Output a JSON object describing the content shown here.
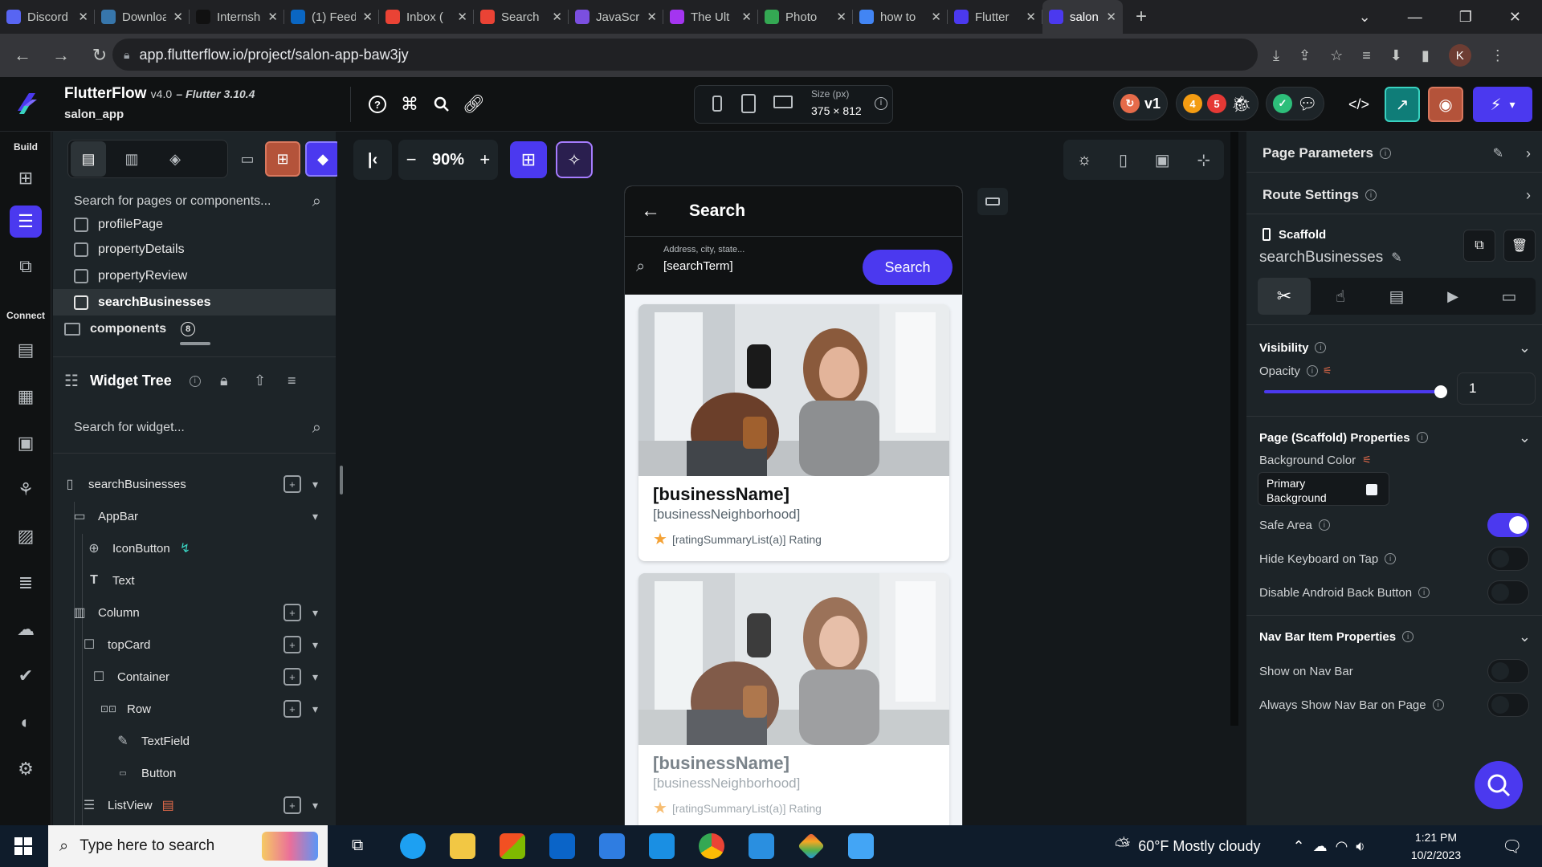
{
  "browser": {
    "tabs": [
      {
        "title": "Discord",
        "icon": "discord-icon",
        "color": "#5865f2"
      },
      {
        "title": "Download",
        "icon": "python-icon",
        "color": "#3776ab"
      },
      {
        "title": "Internship",
        "icon": "medium-icon",
        "color": "#111111"
      },
      {
        "title": "(1) Feed",
        "icon": "linkedin-icon",
        "color": "#0a66c2"
      },
      {
        "title": "Inbox (",
        "icon": "gmail-icon",
        "color": "#ea4335"
      },
      {
        "title": "Search",
        "icon": "gmail-icon",
        "color": "#ea4335"
      },
      {
        "title": "JavaScript",
        "icon": "brackets-icon",
        "color": "#7b4fe0"
      },
      {
        "title": "The Ult",
        "icon": "udemy-icon",
        "color": "#a435f0"
      },
      {
        "title": "Photo",
        "icon": "pinwheel-icon",
        "color": "#34a853"
      },
      {
        "title": "how to",
        "icon": "google-icon",
        "color": "#4285f4"
      },
      {
        "title": "Flutter",
        "icon": "flutterflow-icon",
        "color": "#4b39ef"
      },
      {
        "title": "salon a",
        "icon": "flutterflow-icon",
        "color": "#4b39ef",
        "active": true
      }
    ],
    "url": "app.flutterflow.io/project/salon-app-baw3jy",
    "profile_initial": "K"
  },
  "header": {
    "app_name": "FlutterFlow",
    "version": "v4.0",
    "flutter_version": "– Flutter 3.10.4",
    "project_name": "salon_app",
    "size_label": "Size (px)",
    "size_value": "375 × 812",
    "version_tag": "v1",
    "badge_orange": "4",
    "badge_red": "5"
  },
  "rail": {
    "build_label": "Build",
    "connect_label": "Connect"
  },
  "pages_panel": {
    "search_placeholder": "Search for pages or components...",
    "pages": [
      "profilePage",
      "propertyDetails",
      "propertyReview",
      "searchBusinesses"
    ],
    "active_page": "searchBusinesses",
    "components_label": "components",
    "components_count": "8"
  },
  "widget_tree": {
    "title": "Widget Tree",
    "search_placeholder": "Search for widget...",
    "nodes": [
      {
        "label": "searchBusinesses",
        "icon": "phone-icon"
      },
      {
        "label": "AppBar",
        "icon": "appbar-icon"
      },
      {
        "label": "IconButton",
        "icon": "plus-square-icon"
      },
      {
        "label": "Text",
        "icon": "text-icon"
      },
      {
        "label": "Column",
        "icon": "column-icon"
      },
      {
        "label": "topCard",
        "icon": "square-icon"
      },
      {
        "label": "Container",
        "icon": "square-icon"
      },
      {
        "label": "Row",
        "icon": "row-icon"
      },
      {
        "label": "TextField",
        "icon": "edit-icon"
      },
      {
        "label": "Button",
        "icon": "button-icon"
      },
      {
        "label": "ListView",
        "icon": "list-icon"
      }
    ]
  },
  "canvas": {
    "zoom": "90%"
  },
  "phone": {
    "title": "Search",
    "search_hint": "Address, city, state...",
    "search_value": "[searchTerm]",
    "search_button": "Search",
    "cards": [
      {
        "name": "[businessName]",
        "neighborhood": "[businessNeighborhood]",
        "rating": "[ratingSummaryList(a)] Rating"
      },
      {
        "name": "[businessName]",
        "neighborhood": "[businessNeighborhood]",
        "rating": "[ratingSummaryList(a)] Rating"
      }
    ]
  },
  "properties": {
    "page_parameters": "Page Parameters",
    "route_settings": "Route Settings",
    "widget_type": "Scaffold",
    "widget_name": "searchBusinesses",
    "visibility": "Visibility",
    "opacity_label": "Opacity",
    "opacity_value": "1",
    "opacity_level": 1,
    "scaffold_props": "Page (Scaffold) Properties",
    "bg_color_label": "Background Color",
    "bg_color_value": "Primary Background",
    "safe_area": "Safe Area",
    "safe_area_on": true,
    "hide_keyboard": "Hide Keyboard on Tap",
    "hide_keyboard_on": false,
    "disable_back": "Disable Android Back Button",
    "disable_back_on": false,
    "navbar_props": "Nav Bar Item Properties",
    "show_navbar": "Show on Nav Bar",
    "show_navbar_on": false,
    "always_navbar": "Always Show Nav Bar on Page",
    "always_navbar_on": false
  },
  "taskbar": {
    "search_placeholder": "Type here to search",
    "weather": "60°F  Mostly cloudy",
    "time": "1:21 PM",
    "date": "10/2/2023"
  },
  "colors": {
    "primary": "#4b39ef",
    "accent_orange": "#b4533a",
    "background": "#14181b",
    "panel": "#1d2428"
  }
}
